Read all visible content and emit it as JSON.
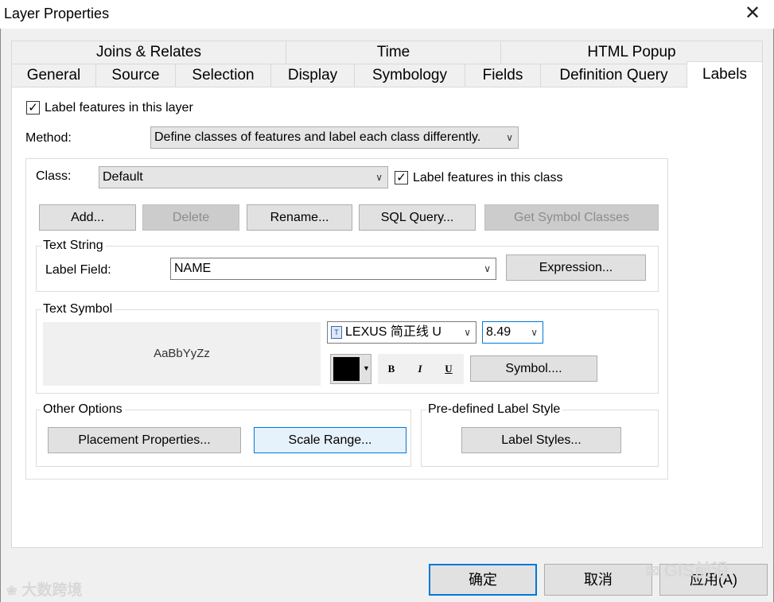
{
  "window": {
    "title": "Layer Properties"
  },
  "tabs_top": [
    "Joins & Relates",
    "Time",
    "HTML Popup"
  ],
  "tabs_bottom": [
    "General",
    "Source",
    "Selection",
    "Display",
    "Symbology",
    "Fields",
    "Definition Query",
    "Labels"
  ],
  "active_tab": "Labels",
  "labels_page": {
    "label_features_layer": "Label features in this layer",
    "method_label": "Method:",
    "method_value": "Define classes of features and label each class differently.",
    "class_label": "Class:",
    "class_value": "Default",
    "label_features_class": "Label features in this class",
    "buttons": {
      "add": "Add...",
      "delete": "Delete",
      "rename": "Rename...",
      "sql_query": "SQL Query...",
      "get_symbol_classes": "Get Symbol Classes"
    },
    "text_string": {
      "group_title": "Text String",
      "label_field_label": "Label Field:",
      "label_field_value": "NAME",
      "expression_button": "Expression..."
    },
    "text_symbol": {
      "group_title": "Text Symbol",
      "preview_text": "AaBbYyZz",
      "font_name": "LEXUS 简正线 U",
      "font_size": "8.49",
      "color": "#000000",
      "bold": "B",
      "italic": "I",
      "underline": "U",
      "symbol_button": "Symbol...."
    },
    "other_options": {
      "group_title": "Other Options",
      "placement_button": "Placement Properties...",
      "scale_range_button": "Scale Range..."
    },
    "predefined": {
      "group_title": "Pre-defined Label Style",
      "label_styles_button": "Label Styles..."
    }
  },
  "footer": {
    "ok": "确定",
    "cancel": "取消",
    "apply": "应用(A)"
  },
  "watermarks": {
    "left": "大数跨境",
    "right": "GIS前沿"
  }
}
